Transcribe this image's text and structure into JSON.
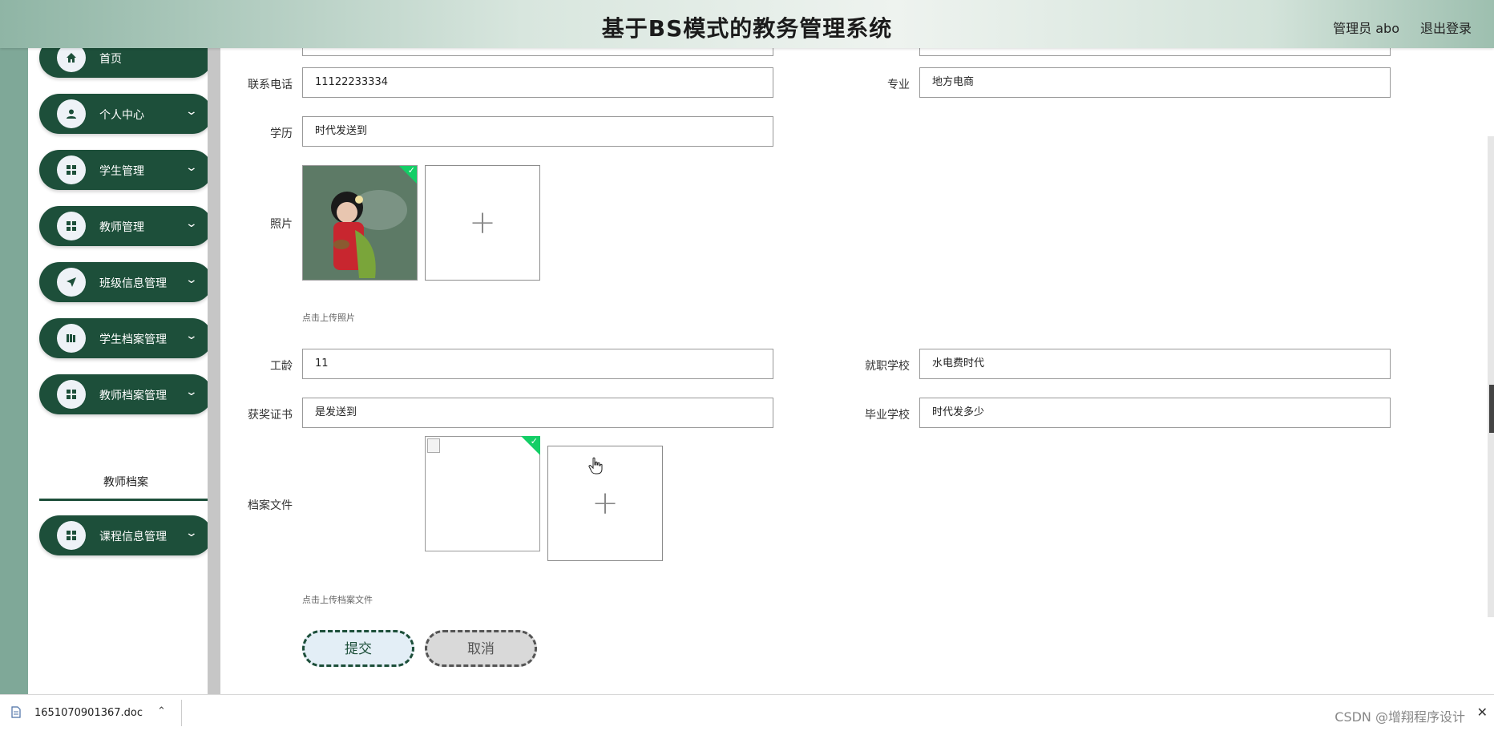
{
  "header": {
    "title": "基于BS模式的教务管理系统",
    "user_label": "管理员 abo",
    "logout_label": "退出登录"
  },
  "sidebar": {
    "items": [
      {
        "label": "首页",
        "icon": "home-icon",
        "has_chevron": false
      },
      {
        "label": "个人中心",
        "icon": "user-icon",
        "has_chevron": true
      },
      {
        "label": "学生管理",
        "icon": "grid-icon",
        "has_chevron": true
      },
      {
        "label": "教师管理",
        "icon": "grid-icon",
        "has_chevron": true
      },
      {
        "label": "班级信息管理",
        "icon": "send-icon",
        "has_chevron": true
      },
      {
        "label": "学生档案管理",
        "icon": "book-icon",
        "has_chevron": true
      },
      {
        "label": "教师档案管理",
        "icon": "grid-icon",
        "has_chevron": true
      },
      {
        "label": "课程信息管理",
        "icon": "grid-icon",
        "has_chevron": true
      }
    ],
    "submenu": {
      "label": "教师档案"
    },
    "chevron": "⌄"
  },
  "form": {
    "phone": {
      "label": "联系电话",
      "value": "11122233334"
    },
    "major": {
      "label": "专业",
      "value": "地方电商"
    },
    "education": {
      "label": "学历",
      "value": "时代发送到"
    },
    "photo": {
      "label": "照片",
      "hint": "点击上传照片"
    },
    "work_years": {
      "label": "工龄",
      "value": "11"
    },
    "school": {
      "label": "就职学校",
      "value": "水电费时代"
    },
    "certificate": {
      "label": "获奖证书",
      "value": "是发送到"
    },
    "graduate_school": {
      "label": "毕业学校",
      "value": "时代发多少"
    },
    "archive_file": {
      "label": "档案文件",
      "hint": "点击上传档案文件"
    },
    "plus": "+",
    "check": "✓"
  },
  "buttons": {
    "submit": "提交",
    "cancel": "取消"
  },
  "download_bar": {
    "file_name": "1651070901367.doc",
    "caret": "⌃",
    "credit": "CSDN @增翔程序设计",
    "close": "✕"
  },
  "colors": {
    "sidebar_green": "#1d4f3a",
    "success_green": "#13ce66"
  }
}
